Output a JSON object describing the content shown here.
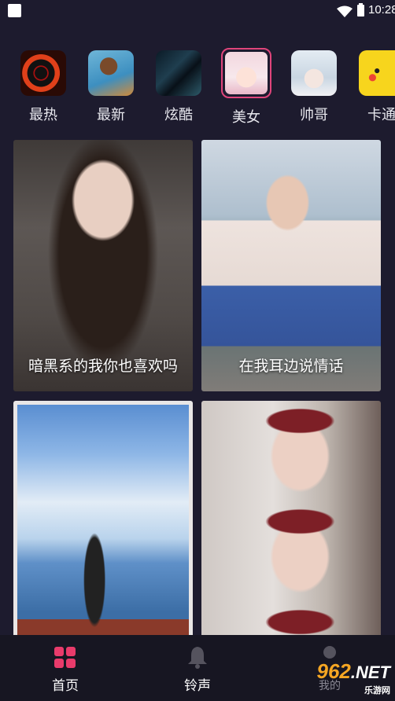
{
  "status": {
    "time": "10:28"
  },
  "categories": [
    {
      "label": "最热",
      "icon": "vinyl-fire-icon"
    },
    {
      "label": "最新",
      "icon": "bear-violin-icon"
    },
    {
      "label": "炫酷",
      "icon": "dark-warrior-icon"
    },
    {
      "label": "美女",
      "icon": "anime-girl-icon",
      "active": true
    },
    {
      "label": "帅哥",
      "icon": "anime-boy-icon"
    },
    {
      "label": "卡通",
      "icon": "pikachu-icon"
    }
  ],
  "cards": [
    {
      "caption": "暗黑系的我你也喜欢吗"
    },
    {
      "caption": "在我耳边说情话"
    },
    {
      "caption": ""
    },
    {
      "caption": ""
    }
  ],
  "tabs": [
    {
      "label": "首页",
      "icon": "grid-icon",
      "active": true
    },
    {
      "label": "铃声",
      "icon": "bell-icon"
    },
    {
      "label": "我的",
      "icon": "profile-icon"
    }
  ],
  "watermark": {
    "number": "962",
    "suffix": ".NET",
    "subtitle": "乐游网"
  },
  "colors": {
    "background": "#1d1b2e",
    "accent": "#e93b6b",
    "tabbar": "#171622"
  }
}
